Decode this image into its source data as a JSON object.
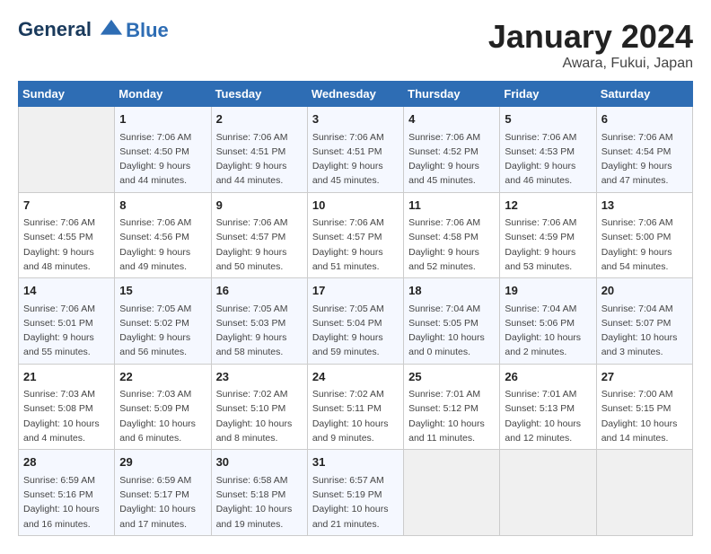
{
  "header": {
    "logo_line1": "General",
    "logo_line2": "Blue",
    "month": "January 2024",
    "location": "Awara, Fukui, Japan"
  },
  "days_of_week": [
    "Sunday",
    "Monday",
    "Tuesday",
    "Wednesday",
    "Thursday",
    "Friday",
    "Saturday"
  ],
  "weeks": [
    [
      {
        "day": "",
        "sunrise": "",
        "sunset": "",
        "daylight": "",
        "empty": true
      },
      {
        "day": "1",
        "sunrise": "Sunrise: 7:06 AM",
        "sunset": "Sunset: 4:50 PM",
        "daylight": "Daylight: 9 hours and 44 minutes."
      },
      {
        "day": "2",
        "sunrise": "Sunrise: 7:06 AM",
        "sunset": "Sunset: 4:51 PM",
        "daylight": "Daylight: 9 hours and 44 minutes."
      },
      {
        "day": "3",
        "sunrise": "Sunrise: 7:06 AM",
        "sunset": "Sunset: 4:51 PM",
        "daylight": "Daylight: 9 hours and 45 minutes."
      },
      {
        "day": "4",
        "sunrise": "Sunrise: 7:06 AM",
        "sunset": "Sunset: 4:52 PM",
        "daylight": "Daylight: 9 hours and 45 minutes."
      },
      {
        "day": "5",
        "sunrise": "Sunrise: 7:06 AM",
        "sunset": "Sunset: 4:53 PM",
        "daylight": "Daylight: 9 hours and 46 minutes."
      },
      {
        "day": "6",
        "sunrise": "Sunrise: 7:06 AM",
        "sunset": "Sunset: 4:54 PM",
        "daylight": "Daylight: 9 hours and 47 minutes."
      }
    ],
    [
      {
        "day": "7",
        "sunrise": "Sunrise: 7:06 AM",
        "sunset": "Sunset: 4:55 PM",
        "daylight": "Daylight: 9 hours and 48 minutes."
      },
      {
        "day": "8",
        "sunrise": "Sunrise: 7:06 AM",
        "sunset": "Sunset: 4:56 PM",
        "daylight": "Daylight: 9 hours and 49 minutes."
      },
      {
        "day": "9",
        "sunrise": "Sunrise: 7:06 AM",
        "sunset": "Sunset: 4:57 PM",
        "daylight": "Daylight: 9 hours and 50 minutes."
      },
      {
        "day": "10",
        "sunrise": "Sunrise: 7:06 AM",
        "sunset": "Sunset: 4:57 PM",
        "daylight": "Daylight: 9 hours and 51 minutes."
      },
      {
        "day": "11",
        "sunrise": "Sunrise: 7:06 AM",
        "sunset": "Sunset: 4:58 PM",
        "daylight": "Daylight: 9 hours and 52 minutes."
      },
      {
        "day": "12",
        "sunrise": "Sunrise: 7:06 AM",
        "sunset": "Sunset: 4:59 PM",
        "daylight": "Daylight: 9 hours and 53 minutes."
      },
      {
        "day": "13",
        "sunrise": "Sunrise: 7:06 AM",
        "sunset": "Sunset: 5:00 PM",
        "daylight": "Daylight: 9 hours and 54 minutes."
      }
    ],
    [
      {
        "day": "14",
        "sunrise": "Sunrise: 7:06 AM",
        "sunset": "Sunset: 5:01 PM",
        "daylight": "Daylight: 9 hours and 55 minutes."
      },
      {
        "day": "15",
        "sunrise": "Sunrise: 7:05 AM",
        "sunset": "Sunset: 5:02 PM",
        "daylight": "Daylight: 9 hours and 56 minutes."
      },
      {
        "day": "16",
        "sunrise": "Sunrise: 7:05 AM",
        "sunset": "Sunset: 5:03 PM",
        "daylight": "Daylight: 9 hours and 58 minutes."
      },
      {
        "day": "17",
        "sunrise": "Sunrise: 7:05 AM",
        "sunset": "Sunset: 5:04 PM",
        "daylight": "Daylight: 9 hours and 59 minutes."
      },
      {
        "day": "18",
        "sunrise": "Sunrise: 7:04 AM",
        "sunset": "Sunset: 5:05 PM",
        "daylight": "Daylight: 10 hours and 0 minutes."
      },
      {
        "day": "19",
        "sunrise": "Sunrise: 7:04 AM",
        "sunset": "Sunset: 5:06 PM",
        "daylight": "Daylight: 10 hours and 2 minutes."
      },
      {
        "day": "20",
        "sunrise": "Sunrise: 7:04 AM",
        "sunset": "Sunset: 5:07 PM",
        "daylight": "Daylight: 10 hours and 3 minutes."
      }
    ],
    [
      {
        "day": "21",
        "sunrise": "Sunrise: 7:03 AM",
        "sunset": "Sunset: 5:08 PM",
        "daylight": "Daylight: 10 hours and 4 minutes."
      },
      {
        "day": "22",
        "sunrise": "Sunrise: 7:03 AM",
        "sunset": "Sunset: 5:09 PM",
        "daylight": "Daylight: 10 hours and 6 minutes."
      },
      {
        "day": "23",
        "sunrise": "Sunrise: 7:02 AM",
        "sunset": "Sunset: 5:10 PM",
        "daylight": "Daylight: 10 hours and 8 minutes."
      },
      {
        "day": "24",
        "sunrise": "Sunrise: 7:02 AM",
        "sunset": "Sunset: 5:11 PM",
        "daylight": "Daylight: 10 hours and 9 minutes."
      },
      {
        "day": "25",
        "sunrise": "Sunrise: 7:01 AM",
        "sunset": "Sunset: 5:12 PM",
        "daylight": "Daylight: 10 hours and 11 minutes."
      },
      {
        "day": "26",
        "sunrise": "Sunrise: 7:01 AM",
        "sunset": "Sunset: 5:13 PM",
        "daylight": "Daylight: 10 hours and 12 minutes."
      },
      {
        "day": "27",
        "sunrise": "Sunrise: 7:00 AM",
        "sunset": "Sunset: 5:15 PM",
        "daylight": "Daylight: 10 hours and 14 minutes."
      }
    ],
    [
      {
        "day": "28",
        "sunrise": "Sunrise: 6:59 AM",
        "sunset": "Sunset: 5:16 PM",
        "daylight": "Daylight: 10 hours and 16 minutes."
      },
      {
        "day": "29",
        "sunrise": "Sunrise: 6:59 AM",
        "sunset": "Sunset: 5:17 PM",
        "daylight": "Daylight: 10 hours and 17 minutes."
      },
      {
        "day": "30",
        "sunrise": "Sunrise: 6:58 AM",
        "sunset": "Sunset: 5:18 PM",
        "daylight": "Daylight: 10 hours and 19 minutes."
      },
      {
        "day": "31",
        "sunrise": "Sunrise: 6:57 AM",
        "sunset": "Sunset: 5:19 PM",
        "daylight": "Daylight: 10 hours and 21 minutes."
      },
      {
        "day": "",
        "sunrise": "",
        "sunset": "",
        "daylight": "",
        "empty": true
      },
      {
        "day": "",
        "sunrise": "",
        "sunset": "",
        "daylight": "",
        "empty": true
      },
      {
        "day": "",
        "sunrise": "",
        "sunset": "",
        "daylight": "",
        "empty": true
      }
    ]
  ]
}
